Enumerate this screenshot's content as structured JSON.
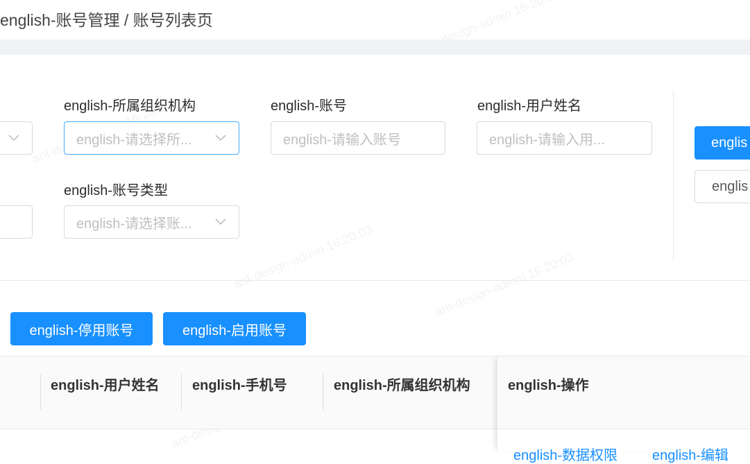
{
  "breadcrumb": "english-账号管理 / 账号列表页",
  "filters": {
    "org": {
      "label": "english-所属组织机构",
      "placeholder": "english-请选择所..."
    },
    "account": {
      "label": "english-账号",
      "placeholder": "english-请输入账号"
    },
    "username": {
      "label": "english-用户姓名",
      "placeholder": "english-请输入用..."
    },
    "account_type": {
      "label": "english-账号类型",
      "placeholder": "english-请选择账..."
    }
  },
  "side_buttons": {
    "primary_label": "englis",
    "secondary_label": "englis"
  },
  "actions": {
    "disable_label": "english-停用账号",
    "enable_label": "english-启用账号"
  },
  "table": {
    "columns": [
      "english-用户姓名",
      "english-手机号",
      "english-所属组织机构",
      "english-操作"
    ]
  },
  "row_actions": {
    "data_permission_label": "english-数据权限",
    "edit_label": "english-编辑"
  },
  "watermark_text": "ant-design-admin 16:20:03",
  "colors": {
    "primary": "#1890ff",
    "border": "#d9d9d9",
    "band": "#f0f2f5"
  }
}
